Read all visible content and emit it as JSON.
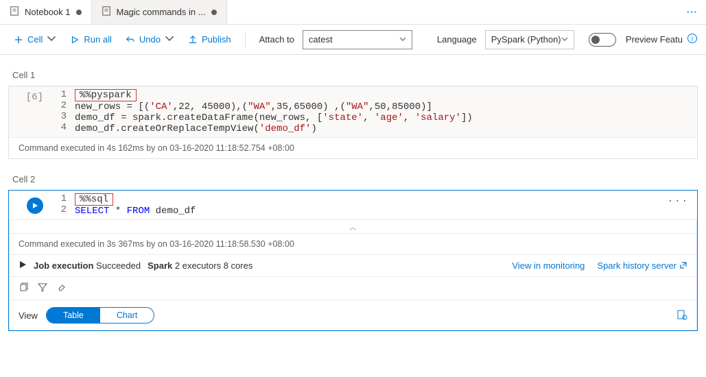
{
  "tabs": {
    "t0": {
      "label": "Notebook 1"
    },
    "t1": {
      "label": "Magic commands in ..."
    }
  },
  "toolbar": {
    "cell": "Cell",
    "runall": "Run all",
    "undo": "Undo",
    "publish": "Publish",
    "attach_label": "Attach to",
    "attach_value": "catest",
    "language_label": "Language",
    "language_value": "PySpark (Python)",
    "preview": "Preview Featu"
  },
  "cell1": {
    "label": "Cell 1",
    "exec_count": "[6]",
    "magic": "%%pyspark",
    "line2a": "new_rows = [(",
    "line2b": ",22, 45000),(",
    "line2c": ",35,65000) ,(",
    "line2d": ",50,85000)]",
    "str_CA": "'CA'",
    "str_WA": "\"WA\"",
    "line3a": "demo_df = spark.createDataFrame(new_rows, [",
    "line3b": "])",
    "str_state": "'state'",
    "str_age": "'age'",
    "str_salary": "'salary'",
    "line4a": "demo_df.createOrReplaceTempView(",
    "line4b": ")",
    "str_demo": "'demo_df'",
    "status": "Command executed in 4s 162ms by       on 03-16-2020 11:18:52.754 +08:00"
  },
  "cell2": {
    "label": "Cell 2",
    "magic": "%%sql",
    "kw_select": "SELECT",
    "star": " * ",
    "kw_from": "FROM",
    "table": " demo_df",
    "status": "Command executed in 3s 367ms by       on 03-16-2020 11:18:58.530 +08:00",
    "job_label": "Job execution",
    "job_status": "Succeeded",
    "spark_label": "Spark",
    "spark_detail": "2 executors 8 cores",
    "link_monitoring": "View in monitoring",
    "link_history": "Spark history server",
    "view_label": "View",
    "seg_table": "Table",
    "seg_chart": "Chart"
  }
}
